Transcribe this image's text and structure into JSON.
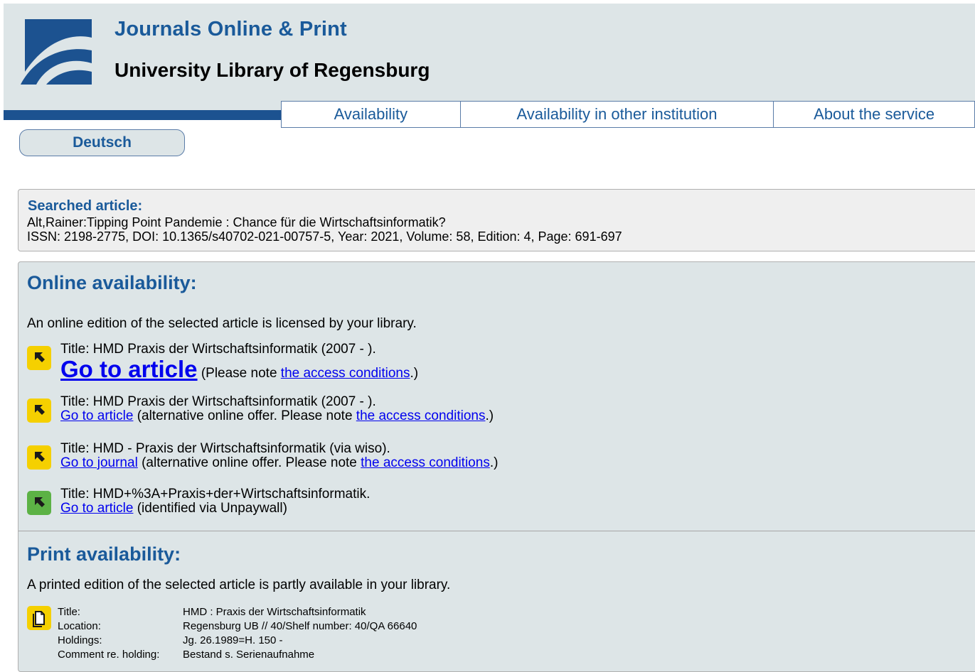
{
  "header": {
    "site_title": "Journals Online & Print",
    "library_name": "University Library of Regensburg",
    "brand_color": "#1c5290",
    "logo_icon": "stylized-arcs-logo-icon"
  },
  "nav": {
    "tabs": [
      {
        "label": "Availability"
      },
      {
        "label": "Availability in other institution"
      },
      {
        "label": "About the service"
      }
    ]
  },
  "language_button": "Deutsch",
  "search": {
    "heading": "Searched article:",
    "citation": "Alt,Rainer:Tipping Point Pandemie : Chance für die Wirtschaftsinformatik?",
    "details": "ISSN: 2198-2775, DOI: 10.1365/s40702-021-00757-5, Year: 2021, Volume: 58, Edition: 4, Page: 691-697"
  },
  "online": {
    "heading": "Online availability:",
    "intro": "An online edition of the selected article is licensed by your library.",
    "entries": [
      {
        "icon": "yellow-arrow-icon",
        "title": "Title: HMD Praxis der Wirtschaftsinformatik (2007 - ).",
        "link": "Go to article",
        "note_prefix": " (Please note ",
        "note_link": "the access conditions",
        "note_suffix": ".)"
      },
      {
        "icon": "yellow-arrow-icon",
        "title": "Title: HMD Praxis der Wirtschaftsinformatik (2007 - ).",
        "link": "Go to article",
        "note_prefix": " (alternative online offer. Please note ",
        "note_link": "the access conditions",
        "note_suffix": ".)"
      },
      {
        "icon": "yellow-arrow-icon",
        "title": "Title: HMD - Praxis der Wirtschaftsinformatik (via wiso).",
        "link": "Go to journal",
        "note_prefix": " (alternative online offer. Please note ",
        "note_link": "the access conditions",
        "note_suffix": ".)"
      },
      {
        "icon": "green-arrow-icon",
        "title": "Title: HMD+%3A+Praxis+der+Wirtschaftsinformatik.",
        "link": "Go to article",
        "note_prefix": " (identified via Unpaywall)"
      }
    ]
  },
  "print": {
    "heading": "Print availability:",
    "intro": "A printed edition of the selected article is partly available in your library.",
    "icon": "yellow-document-icon",
    "rows": [
      {
        "label": "Title:",
        "value": "HMD : Praxis der Wirtschaftsinformatik"
      },
      {
        "label": "Location:",
        "value": "Regensburg UB // 40/Shelf number: 40/QA 66640"
      },
      {
        "label": "Holdings:",
        "value": "Jg. 26.1989=H. 150 -"
      },
      {
        "label": "Comment re. holding:",
        "value": "Bestand s. Serienaufnahme"
      }
    ]
  },
  "colors": {
    "yellow_icon": "#f5d000",
    "green_icon": "#5cb245",
    "link": "#0000ee",
    "heading": "#1a5a9a"
  }
}
